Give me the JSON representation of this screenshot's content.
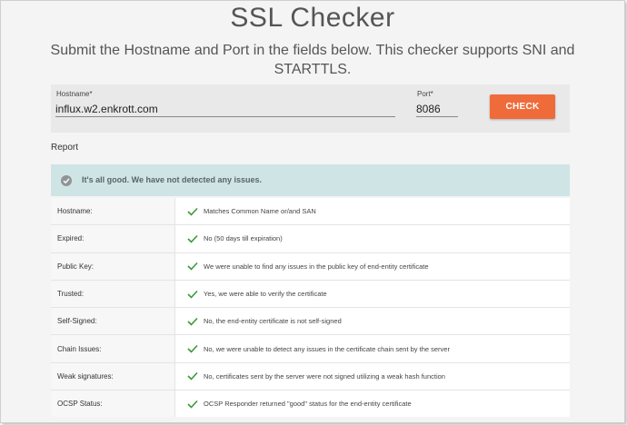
{
  "page": {
    "title": "SSL Checker",
    "subtitle": "Submit the Hostname and Port in the fields below. This checker supports SNI and STARTTLS."
  },
  "form": {
    "hostname_label": "Hostname*",
    "hostname_value": "influx.w2.enkrott.com",
    "port_label": "Port*",
    "port_value": "8086",
    "check_label": "CHECK"
  },
  "report": {
    "heading": "Report",
    "status_text": "It's all good. We have not detected any issues.",
    "rows": [
      {
        "key": "Hostname:",
        "value": "Matches Common Name or/and SAN"
      },
      {
        "key": "Expired:",
        "value": "No (50 days till expiration)"
      },
      {
        "key": "Public Key:",
        "value": "We were unable to find any issues in the public key of end-entity certificate"
      },
      {
        "key": "Trusted:",
        "value": "Yes, we were able to verify the certificate"
      },
      {
        "key": "Self-Signed:",
        "value": "No, the end-entity certificate is not self-signed"
      },
      {
        "key": "Chain Issues:",
        "value": "No, we were unable to detect any issues in the certificate chain sent by the server"
      },
      {
        "key": "Weak signatures:",
        "value": "No, certificates sent by the server were not signed utilizing a weak hash function"
      },
      {
        "key": "OCSP Status:",
        "value": "OCSP Responder returned \"good\" status for the end-entity certificate"
      }
    ]
  },
  "colors": {
    "accent": "#ef6c3a",
    "status_bg": "#cfe4e5",
    "ok_check": "#3a9a3a"
  },
  "icons": {
    "status": "check-circle-icon",
    "row_status": "checkmark-icon"
  }
}
